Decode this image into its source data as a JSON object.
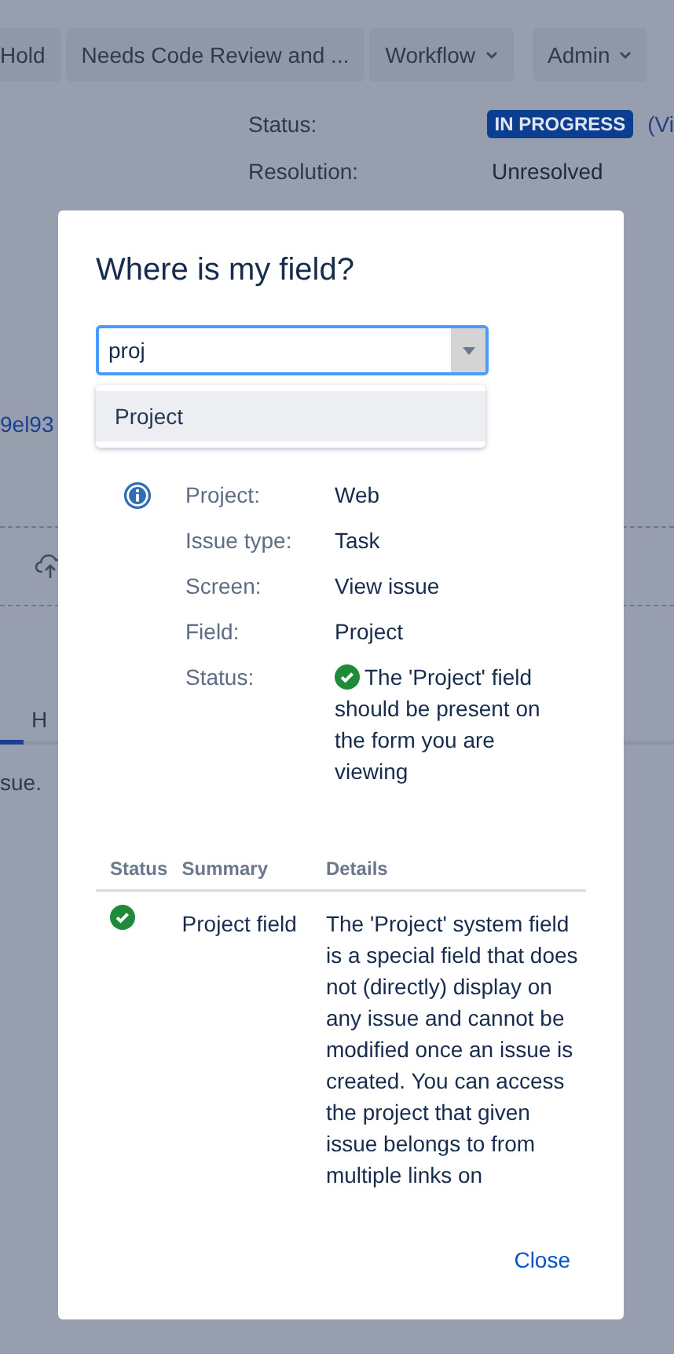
{
  "toolbar": [
    {
      "label": "Hold",
      "dropdown": false
    },
    {
      "label": "Needs Code Review and ...",
      "dropdown": false
    },
    {
      "label": "Workflow",
      "dropdown": true
    },
    {
      "label": "Admin",
      "dropdown": true
    }
  ],
  "details": [
    {
      "label": "Status:",
      "kind": "lozenge",
      "value": "IN PROGRESS",
      "link": "(Vi"
    },
    {
      "label": "Resolution:",
      "kind": "text",
      "value": "Unresolved"
    }
  ],
  "background": {
    "link": "9el93",
    "tab": "H",
    "text": "sue."
  },
  "dialog": {
    "title": "Where is my field?",
    "search": {
      "value": "proj"
    },
    "suggestions": [
      {
        "label": "Project",
        "selected": true
      }
    ],
    "info": [
      {
        "label": "Project:",
        "kind": "text",
        "value": "Web"
      },
      {
        "label": "Issue type:",
        "kind": "text",
        "value": "Task"
      },
      {
        "label": "Screen:",
        "kind": "text",
        "value": "View issue"
      },
      {
        "label": "Field:",
        "kind": "text",
        "value": "Project"
      },
      {
        "label": "Status:",
        "kind": "status",
        "ok": true,
        "value": "The 'Project' field should be present on the form you are viewing"
      }
    ],
    "table": {
      "columns": [
        "Status",
        "Summary",
        "Details"
      ],
      "rows": [
        {
          "ok": true,
          "summary": "Project field",
          "details": "The 'Project' system field is a special field that does not (directly) display on any issue and cannot be modified once an issue is created. You can access the project that given issue belongs to from multiple links on"
        }
      ]
    },
    "close": "Close"
  }
}
